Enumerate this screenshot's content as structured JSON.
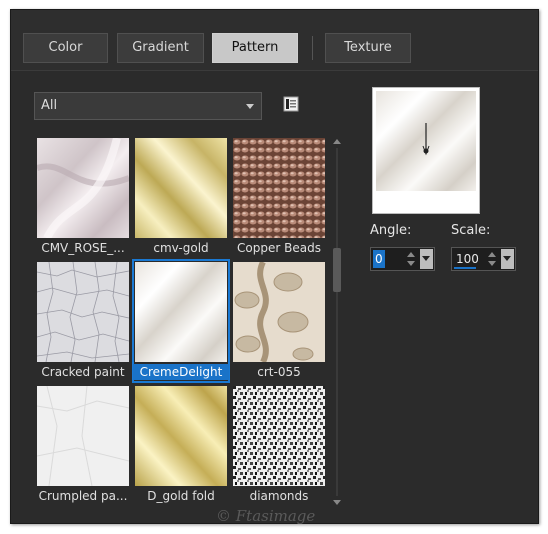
{
  "tabs": [
    {
      "label": "Color",
      "active": false
    },
    {
      "label": "Gradient",
      "active": false
    },
    {
      "label": "Pattern",
      "active": true
    },
    {
      "label": "Texture",
      "active": false
    }
  ],
  "category": {
    "selected": "All"
  },
  "patterns": [
    {
      "name": "CMV_ROSE_...",
      "selected": false
    },
    {
      "name": "cmv-gold",
      "selected": false
    },
    {
      "name": "Copper Beads",
      "selected": false
    },
    {
      "name": "Cracked paint",
      "selected": false
    },
    {
      "name": "CremeDelight",
      "selected": true
    },
    {
      "name": "crt-055",
      "selected": false
    },
    {
      "name": "Crumpled pa...",
      "selected": false
    },
    {
      "name": "D_gold fold",
      "selected": false
    },
    {
      "name": "diamonds",
      "selected": false
    }
  ],
  "angle": {
    "label": "Angle:",
    "value": "0"
  },
  "scale": {
    "label": "Scale:",
    "value": "100"
  },
  "watermark": "© Ftasimage",
  "icons": [
    "library-icon",
    "dropdown-arrow-icon",
    "spin-up-icon",
    "spin-down-icon",
    "scroll-up-icon",
    "scroll-down-icon"
  ],
  "colors": {
    "accent": "#1a73c8",
    "panel": "#2b2b2b"
  }
}
